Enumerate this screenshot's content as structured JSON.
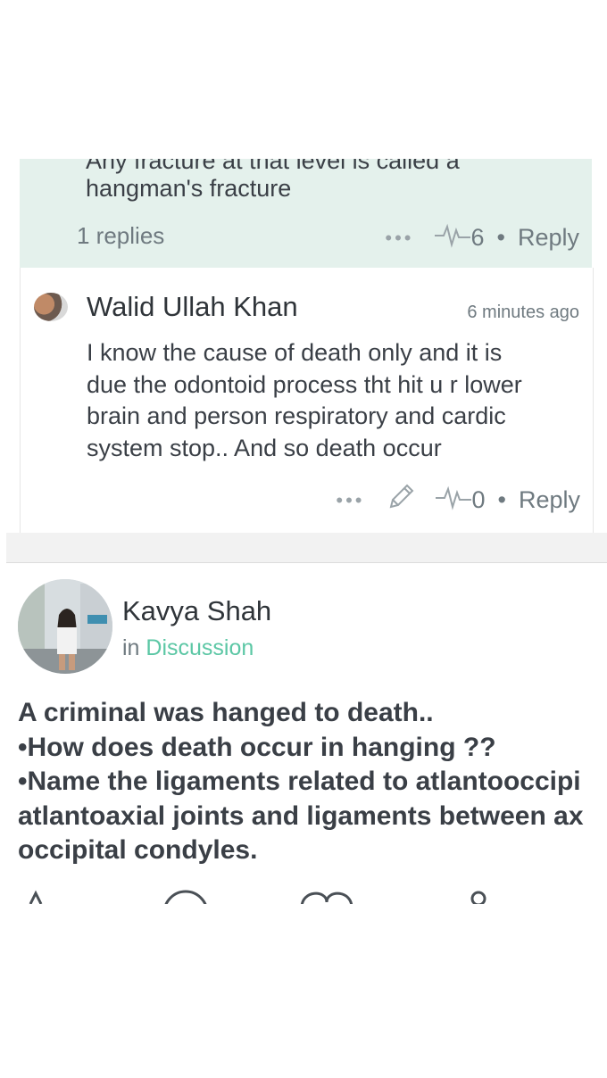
{
  "comment_thread": {
    "first_comment": {
      "partial_line": "Any fracture at that level is called a",
      "text": "hangman's fracture",
      "replies_label": "1 replies",
      "likes": "6",
      "reply_label": "Reply"
    },
    "second_comment": {
      "author": "Walid Ullah Khan",
      "timestamp": "6 minutes ago",
      "body": [
        "I know the cause of death only and it is",
        "due the odontoid process tht hit u r lower",
        "brain and person respiratory and cardic",
        "system stop.. And so death occur"
      ],
      "likes": "0",
      "reply_label": "Reply"
    }
  },
  "post": {
    "author": "Kavya Shah",
    "in_prefix": "in",
    "category": "Discussion",
    "body": [
      "A criminal was hanged to death..",
      "•How does death occur in hanging ??",
      "•Name the ligaments related to atlantooccipi",
      "atlantoaxial joints and ligaments between ax",
      "occipital condyles."
    ]
  },
  "colors": {
    "accent": "#5cc7a5",
    "highlight_bg": "#e4f1ec",
    "text": "#3a3f46",
    "muted": "#6f7a80"
  }
}
